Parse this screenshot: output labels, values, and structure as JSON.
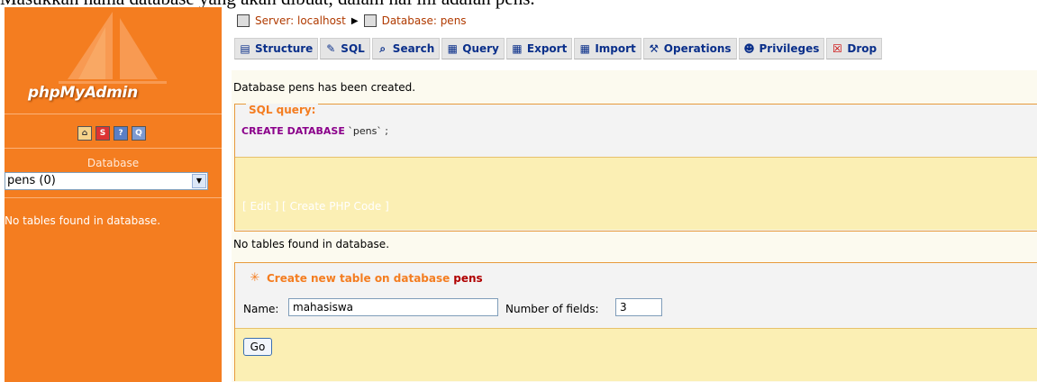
{
  "caption": "Masukkan nama database yang akan dibuat, dalam hal  ini adalah pens.",
  "sidebar": {
    "logo": "phpMyAdmin",
    "icons": [
      "home-icon",
      "sql-icon",
      "help-icon",
      "query-window-icon"
    ],
    "database_label": "Database",
    "database_selected": "pens (0)",
    "empty_message": "No tables found in database."
  },
  "breadcrumb": {
    "server": "Server: localhost",
    "separator": "▶",
    "database": "Database: pens"
  },
  "tabs": [
    {
      "label": "Structure",
      "icon": "structure-icon"
    },
    {
      "label": "SQL",
      "icon": "sql-icon"
    },
    {
      "label": "Search",
      "icon": "search-icon"
    },
    {
      "label": "Query",
      "icon": "query-icon"
    },
    {
      "label": "Export",
      "icon": "export-icon"
    },
    {
      "label": "Import",
      "icon": "import-icon"
    },
    {
      "label": "Operations",
      "icon": "operations-icon"
    },
    {
      "label": "Privileges",
      "icon": "privileges-icon"
    },
    {
      "label": "Drop",
      "icon": "drop-icon"
    }
  ],
  "main": {
    "created_message": "Database pens has been created.",
    "sql_box": {
      "legend": "SQL query:",
      "keyword": "CREATE DATABASE",
      "statement_rest": " `pens` ;",
      "links_open": "[ ",
      "edit_label": "Edit",
      "links_mid": " ] [ ",
      "php_label": "Create PHP Code",
      "links_close": " ]"
    },
    "no_tables_message": "No tables found in database.",
    "create_table": {
      "legend_prefix": "Create new table on database",
      "db_name": "pens",
      "name_label": "Name:",
      "name_value": "mahasiswa",
      "fields_label": "Number of fields:",
      "fields_value": "3",
      "go_label": "Go"
    }
  },
  "colors": {
    "sidebar": "#f47d20",
    "tab_text": "#0a2f8a",
    "legend_text": "#f47d20",
    "sql_keyword": "#8b008b",
    "footer_bg": "#fbefb4",
    "content_bg": "#fcfaef"
  }
}
